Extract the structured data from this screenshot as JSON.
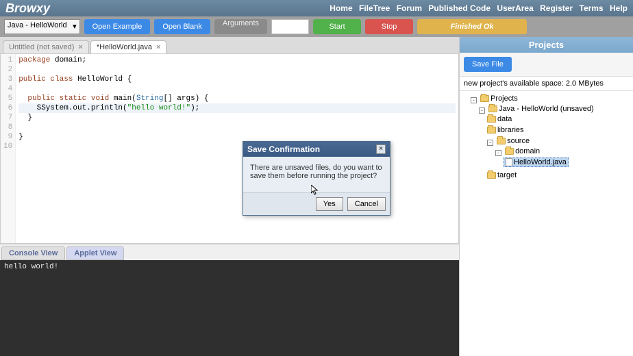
{
  "header": {
    "brand": "Browxy",
    "nav": [
      "Home",
      "FileTree",
      "Forum",
      "Published Code",
      "UserArea",
      "Register",
      "Terms",
      "Help"
    ]
  },
  "toolbar": {
    "project_select": "Java - HelloWorld",
    "open_example": "Open Example",
    "open_blank": "Open Blank",
    "arguments_label": "Arguments",
    "arguments_value": "",
    "start": "Start",
    "stop": "Stop",
    "status": "Finished Ok"
  },
  "tabs": [
    {
      "label": "Untitled (not saved)",
      "active": false
    },
    {
      "label": "*HelloWorld.java",
      "active": true
    }
  ],
  "editor": {
    "line_numbers": [
      "1",
      "2",
      "3",
      "4",
      "5",
      "6",
      "7",
      "8",
      "9",
      "10"
    ],
    "lines": [
      {
        "raw": "package domain;"
      },
      {
        "raw": ""
      },
      {
        "raw": "public class HelloWorld {"
      },
      {
        "raw": ""
      },
      {
        "raw": "  public static void main(String[] args) {"
      },
      {
        "raw": "    SSystem.out.println(\"hello world!\");",
        "hl": true
      },
      {
        "raw": "  }"
      },
      {
        "raw": ""
      },
      {
        "raw": "}"
      },
      {
        "raw": ""
      }
    ]
  },
  "console_tabs": {
    "console": "Console View",
    "applet": "Applet View"
  },
  "console_output": "hello world!",
  "projects_panel": {
    "title": "Projects",
    "save_file": "Save File",
    "space_info": "new project's available space: 2.0 MBytes",
    "tree": {
      "root": "Projects",
      "project": "Java - HelloWorld (unsaved)",
      "data": "data",
      "libraries": "libraries",
      "source": "source",
      "domain": "domain",
      "file": "HelloWorld.java",
      "target": "target"
    }
  },
  "modal": {
    "title": "Save Confirmation",
    "message": "There are unsaved files, do you want to save them before running the project?",
    "yes": "Yes",
    "cancel": "Cancel"
  }
}
